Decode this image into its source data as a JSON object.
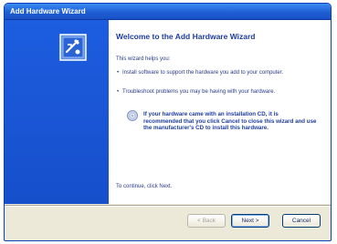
{
  "window": {
    "title": "Add Hardware Wizard"
  },
  "wizard": {
    "heading": "Welcome to the Add Hardware Wizard",
    "intro": "This wizard helps you:",
    "bullets": [
      "Install software to support the hardware you add to your computer.",
      "Troubleshoot problems you may be having with your hardware."
    ],
    "note": "If your hardware came with an installation CD, it is recommended that you click Cancel to close this wizard and use the manufacturer's CD to install this hardware.",
    "continue_text": "To continue, click Next."
  },
  "buttons": {
    "back": "< Back",
    "next": "Next >",
    "cancel": "Cancel"
  },
  "colors": {
    "title_bar": "#1e5fd6",
    "left_pane": "#1a56d4",
    "heading": "#1d3d9e"
  },
  "icons": {
    "wizard": "hardware-wizard-icon",
    "cd": "cd-icon"
  }
}
